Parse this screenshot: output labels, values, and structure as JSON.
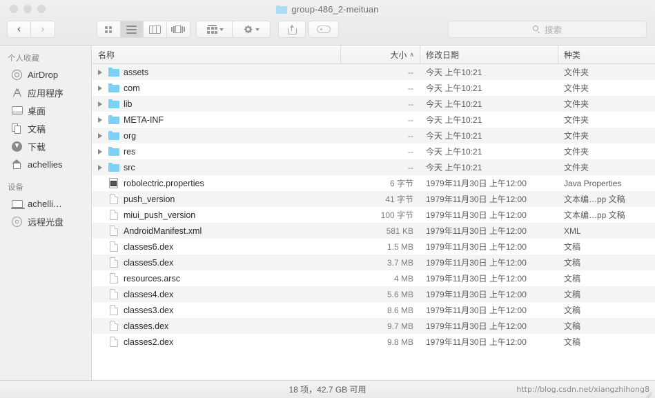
{
  "window": {
    "title": "group-486_2-meituan",
    "folder_icon": "folder-icon"
  },
  "traffic_lights": {
    "close": "close-button",
    "minimize": "minimize-button",
    "zoom": "zoom-button"
  },
  "toolbar": {
    "back_glyph": "‹",
    "forward_glyph": "›",
    "view_modes": [
      {
        "name": "icon-view",
        "active": false
      },
      {
        "name": "list-view",
        "active": true
      },
      {
        "name": "column-view",
        "active": false
      },
      {
        "name": "coverflow-view",
        "active": false
      }
    ],
    "arrange_label": "arrange-by",
    "action_label": "action-gear",
    "share_label": "share",
    "tag_label": "tags"
  },
  "search": {
    "placeholder": "搜索"
  },
  "sidebar": {
    "sections": [
      {
        "header": "个人收藏",
        "items": [
          {
            "label": "AirDrop",
            "icon": "airdrop-icon"
          },
          {
            "label": "应用程序",
            "icon": "applications-icon"
          },
          {
            "label": "桌面",
            "icon": "desktop-icon"
          },
          {
            "label": "文稿",
            "icon": "documents-icon"
          },
          {
            "label": "下载",
            "icon": "downloads-icon"
          },
          {
            "label": "achellies",
            "icon": "home-icon"
          }
        ]
      },
      {
        "header": "设备",
        "items": [
          {
            "label": "achelli…",
            "icon": "laptop-icon"
          },
          {
            "label": "远程光盘",
            "icon": "remote-disc-icon"
          }
        ]
      }
    ]
  },
  "file_list": {
    "columns": [
      {
        "key": "name",
        "label": "名称"
      },
      {
        "key": "size",
        "label": "大小",
        "sorted": true,
        "sort_arrow": "∧"
      },
      {
        "key": "date",
        "label": "修改日期"
      },
      {
        "key": "kind",
        "label": "种类"
      }
    ],
    "rows": [
      {
        "name": "assets",
        "size": "--",
        "date": "今天 上午10:21",
        "kind": "文件夹",
        "type": "folder"
      },
      {
        "name": "com",
        "size": "--",
        "date": "今天 上午10:21",
        "kind": "文件夹",
        "type": "folder"
      },
      {
        "name": "lib",
        "size": "--",
        "date": "今天 上午10:21",
        "kind": "文件夹",
        "type": "folder"
      },
      {
        "name": "META-INF",
        "size": "--",
        "date": "今天 上午10:21",
        "kind": "文件夹",
        "type": "folder"
      },
      {
        "name": "org",
        "size": "--",
        "date": "今天 上午10:21",
        "kind": "文件夹",
        "type": "folder"
      },
      {
        "name": "res",
        "size": "--",
        "date": "今天 上午10:21",
        "kind": "文件夹",
        "type": "folder"
      },
      {
        "name": "src",
        "size": "--",
        "date": "今天 上午10:21",
        "kind": "文件夹",
        "type": "folder"
      },
      {
        "name": "robolectric.properties",
        "size": "6 字节",
        "date": "1979年11月30日 上午12:00",
        "kind": "Java Properties",
        "type": "properties"
      },
      {
        "name": "push_version",
        "size": "41 字节",
        "date": "1979年11月30日 上午12:00",
        "kind": "文本编…pp 文稿",
        "type": "doc"
      },
      {
        "name": "miui_push_version",
        "size": "100 字节",
        "date": "1979年11月30日 上午12:00",
        "kind": "文本编…pp 文稿",
        "type": "doc"
      },
      {
        "name": "AndroidManifest.xml",
        "size": "581 KB",
        "date": "1979年11月30日 上午12:00",
        "kind": "XML",
        "type": "doc"
      },
      {
        "name": "classes6.dex",
        "size": "1.5 MB",
        "date": "1979年11月30日 上午12:00",
        "kind": "文稿",
        "type": "doc"
      },
      {
        "name": "classes5.dex",
        "size": "3.7 MB",
        "date": "1979年11月30日 上午12:00",
        "kind": "文稿",
        "type": "doc"
      },
      {
        "name": "resources.arsc",
        "size": "4 MB",
        "date": "1979年11月30日 上午12:00",
        "kind": "文稿",
        "type": "doc"
      },
      {
        "name": "classes4.dex",
        "size": "5.6 MB",
        "date": "1979年11月30日 上午12:00",
        "kind": "文稿",
        "type": "doc"
      },
      {
        "name": "classes3.dex",
        "size": "8.6 MB",
        "date": "1979年11月30日 上午12:00",
        "kind": "文稿",
        "type": "doc"
      },
      {
        "name": "classes.dex",
        "size": "9.7 MB",
        "date": "1979年11月30日 上午12:00",
        "kind": "文稿",
        "type": "doc"
      },
      {
        "name": "classes2.dex",
        "size": "9.8 MB",
        "date": "1979年11月30日 上午12:00",
        "kind": "文稿",
        "type": "doc"
      }
    ]
  },
  "status": {
    "summary": "18 项，42.7 GB 可用",
    "watermark": "http://blog.csdn.net/xiangzhihong8"
  },
  "colors": {
    "folder_blue": "#7fd0f5",
    "title_blue": "#abddf8",
    "sidebar_bg": "#f0f0f0",
    "row_alt": "#f4f4f5"
  }
}
